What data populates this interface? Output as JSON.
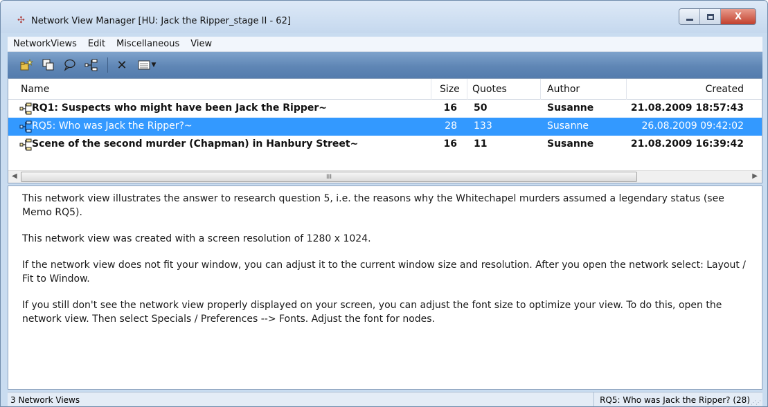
{
  "window": {
    "title": "Network View Manager [HU: Jack the Ripper_stage II - 62]",
    "close_label": "X"
  },
  "menu": [
    {
      "label": "NetworkViews"
    },
    {
      "label": "Edit"
    },
    {
      "label": "Miscellaneous"
    },
    {
      "label": "View"
    }
  ],
  "toolbar": {
    "buttons": [
      "new-network-view-icon",
      "duplicate-icon",
      "comment-icon",
      "network-view-icon",
      "delete-icon",
      "view-options-icon"
    ],
    "delete_glyph": "✕"
  },
  "list": {
    "headers": {
      "name": "Name",
      "size": "Size",
      "quotes": "Quotes",
      "author": "Author",
      "created": "Created"
    },
    "rows": [
      {
        "name": "RQ1: Suspects who might have been Jack the Ripper~",
        "size": "16",
        "quotes": "50",
        "author": "Susanne",
        "created": "21.08.2009 18:57:43",
        "selected": false
      },
      {
        "name": "RQ5: Who was Jack the Ripper?~",
        "size": "28",
        "quotes": "133",
        "author": "Susanne",
        "created": "26.08.2009 09:42:02",
        "selected": true
      },
      {
        "name": "Scene of the second murder (Chapman) in Hanbury Street~",
        "size": "16",
        "quotes": "11",
        "author": "Susanne",
        "created": "21.08.2009 16:39:42",
        "selected": false
      }
    ],
    "scroll_grip": "III"
  },
  "description": {
    "paragraphs": [
      "This network view illustrates the answer to research question 5, i.e. the reasons why the Whitechapel murders assumed a legendary status (see Memo RQ5).",
      "This network view was created with a screen resolution of 1280 x 1024.",
      "If the network view does not fit your window, you can adjust it to the current window size and resolution. After you open the network select: Layout / Fit to Window.",
      "If you still don't see the network view properly displayed on your screen, you can adjust the font size to optimize your view. To do this, open the network view. Then select Specials / Preferences --> Fonts. Adjust the font for nodes."
    ]
  },
  "status": {
    "left": "3 Network Views",
    "right": "RQ5: Who was Jack the Ripper? (28)"
  },
  "colors": {
    "selection": "#3399ff",
    "toolbar": "#5f86b5",
    "close_button": "#c2402d"
  }
}
